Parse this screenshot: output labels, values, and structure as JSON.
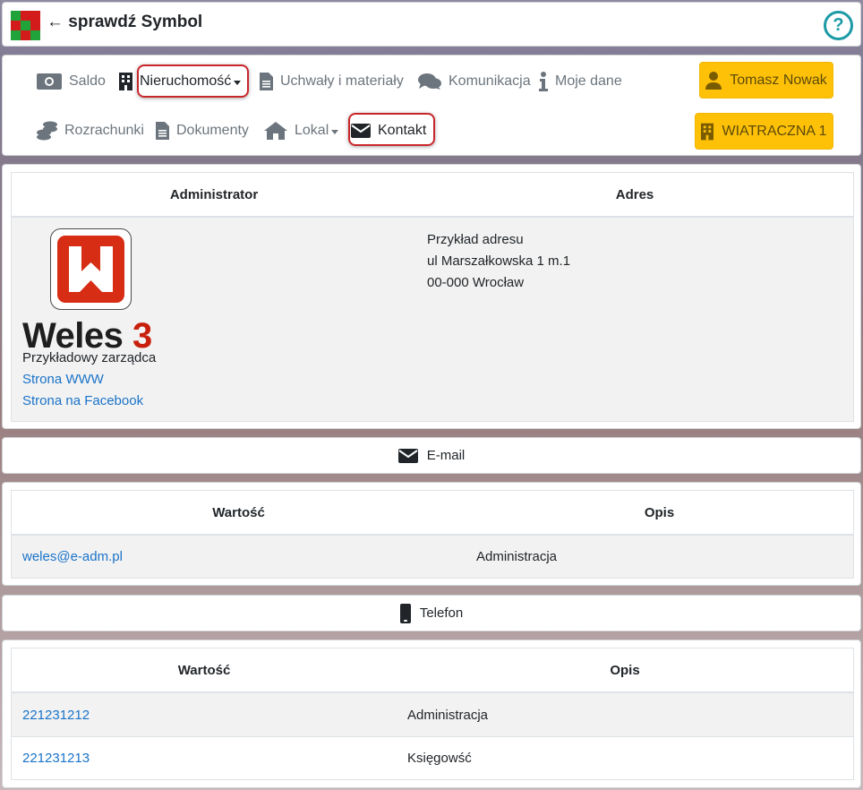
{
  "header": {
    "title": "← sprawdź Symbol",
    "help_label": "?"
  },
  "nav": {
    "row1": [
      {
        "label": "Saldo",
        "icon": "money-icon"
      },
      {
        "label": "Nieruchomość",
        "icon": "building-icon",
        "dropdown": true
      },
      {
        "label": "Uchwały i materiały",
        "icon": "file-icon"
      },
      {
        "label": "Komunikacja",
        "icon": "comments-icon"
      },
      {
        "label": "Moje dane",
        "icon": "info-icon"
      }
    ],
    "row2": [
      {
        "label": "Rozrachunki",
        "icon": "coins-icon"
      },
      {
        "label": "Dokumenty",
        "icon": "file-icon"
      },
      {
        "label": "Lokal",
        "icon": "home-icon",
        "dropdown": true
      },
      {
        "label": "Kontakt",
        "icon": "envelope-icon"
      }
    ],
    "user_button": "Tomasz Nowak",
    "property_button": "WIATRACZNA 1"
  },
  "admin_table": {
    "headers": [
      "Administrator",
      "Adres"
    ],
    "logo_text": "Weles",
    "logo_number": "3",
    "admin_name": "Przykładowy zarządca",
    "link_www": "Strona WWW",
    "link_facebook": "Strona na Facebook",
    "address_lines": [
      "Przykład adresu",
      "ul Marszałkowska 1 m.1",
      "00-000 Wrocław"
    ]
  },
  "email_section": {
    "title": "E-mail",
    "headers": [
      "Wartość",
      "Opis"
    ],
    "rows": [
      {
        "value": "weles@e-adm.pl",
        "desc": "Administracja"
      }
    ]
  },
  "phone_section": {
    "title": "Telefon",
    "headers": [
      "Wartość",
      "Opis"
    ],
    "rows": [
      {
        "value": "221231212",
        "desc": "Administracja"
      },
      {
        "value": "221231213",
        "desc": "Księgowść"
      }
    ]
  },
  "colors": {
    "accent_warning": "#ffc107",
    "link": "#1a73c9",
    "help": "#1b9aa6",
    "highlight": "#c9262b"
  }
}
